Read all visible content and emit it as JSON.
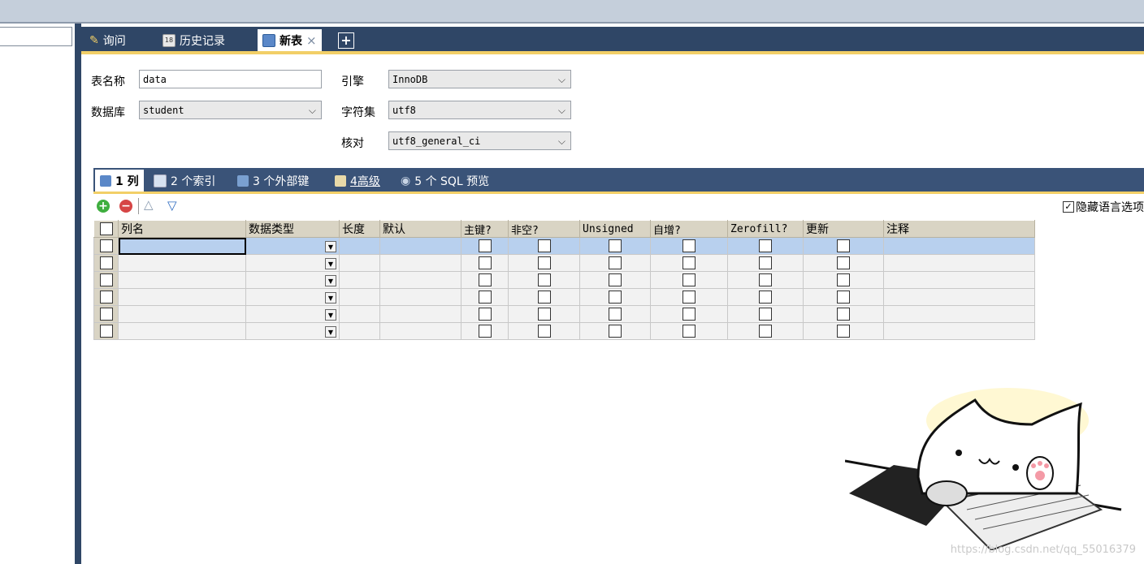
{
  "tabs": [
    {
      "label": "询问",
      "icon": "query-icon"
    },
    {
      "label": "历史记录",
      "icon": "history-icon"
    },
    {
      "label": "新表",
      "icon": "new-table-icon",
      "active": true
    }
  ],
  "close_glyph": "×",
  "add_tab_glyph": "+",
  "form": {
    "table_name_label": "表名称",
    "table_name_value": "data",
    "database_label": "数据库",
    "database_value": "student",
    "engine_label": "引擎",
    "engine_value": "InnoDB",
    "charset_label": "字符集",
    "charset_value": "utf8",
    "collation_label": "核对",
    "collation_value": "utf8_general_ci"
  },
  "subtabs": [
    {
      "label": "1 列",
      "active": true
    },
    {
      "label": "2 个索引"
    },
    {
      "label": "3 个外部键"
    },
    {
      "label": "4高级"
    },
    {
      "label": "5 个 SQL 预览"
    }
  ],
  "toolbar": {
    "hide_language_label": "隐藏语言选项",
    "hide_language_checked": true
  },
  "grid": {
    "headers": [
      "列名",
      "数据类型",
      "长度",
      "默认",
      "主键?",
      "非空?",
      "Unsigned",
      "自增?",
      "Zerofill?",
      "更新",
      "注释"
    ],
    "row_count": 6,
    "selected_row": 0
  },
  "watermark": "https://blog.csdn.net/qq_55016379",
  "colors": {
    "tab_bar": "#2f4666",
    "accent_line": "#f2cf67",
    "selected_row": "#b8d0ee",
    "header_bg": "#d9d4c4"
  }
}
